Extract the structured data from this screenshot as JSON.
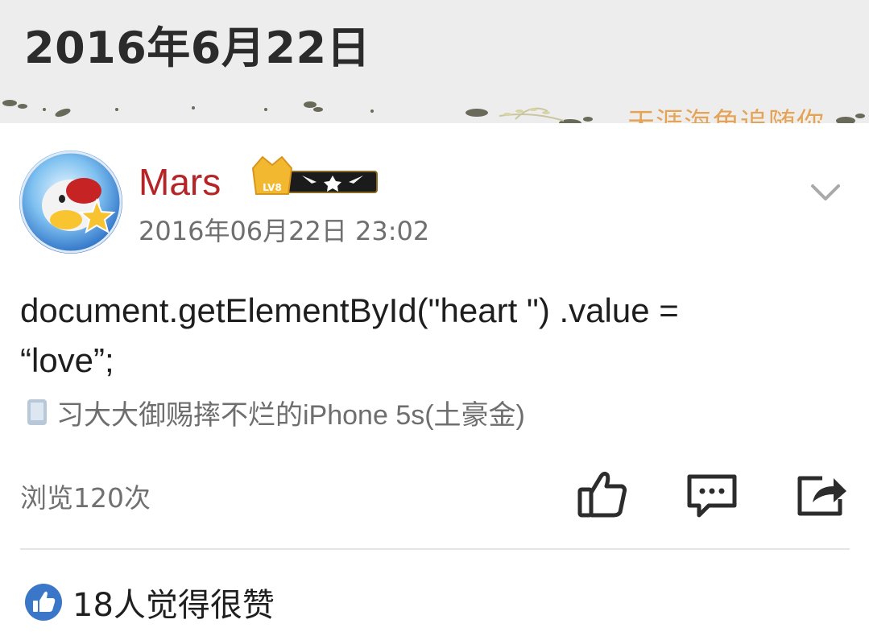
{
  "header": {
    "date_heading": "2016年6月22日",
    "banner_text": "天涯海角追随你"
  },
  "post": {
    "username": "Mars",
    "level_badge": "LV8",
    "timestamp": "2016年06月22日 23:02",
    "content_lines": [
      "document.getElementById(\"heart \") .value =",
      "“love”;"
    ],
    "device": "习大大御赐摔不烂的iPhone 5s(土豪金)",
    "views": "浏览120次",
    "likes_summary": "18人觉得很赞"
  },
  "icons": {
    "menu": "chevron-down-icon",
    "like": "thumbs-up-icon",
    "comment": "comment-bubble-icon",
    "share": "share-icon",
    "device": "phone-icon",
    "likes": "thumbs-up-circle-icon"
  },
  "colors": {
    "username": "#b52426",
    "header_bg": "#ededed",
    "banner_text": "#e2a35c",
    "likes_icon": "#3a77c8",
    "level_badge": "#f2b930"
  }
}
